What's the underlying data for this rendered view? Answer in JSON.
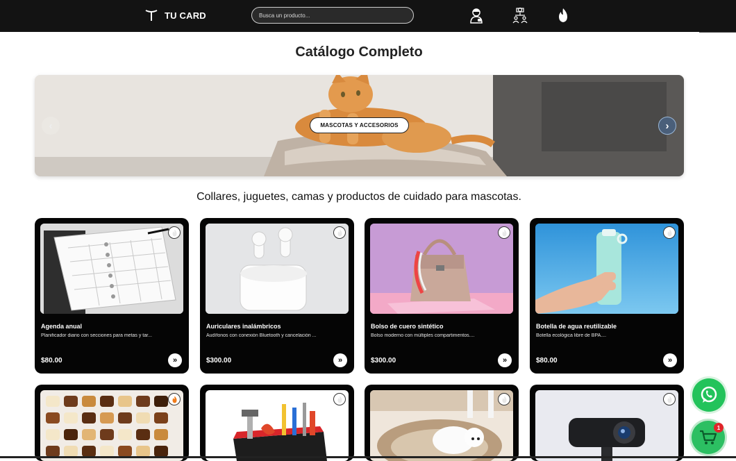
{
  "header": {
    "brand_name": "TU CARD",
    "search_placeholder": "Busca un producto...",
    "nav_icons": [
      "support-agent-icon",
      "team-network-icon",
      "flame-icon"
    ]
  },
  "page_title": "Catálogo Completo",
  "banner": {
    "category_label": "MASCOTAS Y ACCESORIOS",
    "prev_glyph": "‹",
    "next_glyph": "›"
  },
  "category_description": "Collares, juguetes, camas y productos de cuidado para mascotas.",
  "products": [
    {
      "name": "Agenda anual",
      "description": "Planificador diario con secciones para metas y tar...",
      "price": "$80.00",
      "action_glyph": "»"
    },
    {
      "name": "Auriculares inalámbricos",
      "description": "Audífonos con conexión Bluetooth y cancelación ...",
      "price": "$300.00",
      "action_glyph": "»"
    },
    {
      "name": "Bolso de cuero sintético",
      "description": "Bolso moderno con múltiples compartimentos....",
      "price": "$300.00",
      "action_glyph": "»"
    },
    {
      "name": "Botella de agua reutilizable",
      "description": "Botella ecológica libre de BPA....",
      "price": "$80.00",
      "action_glyph": "»"
    }
  ],
  "cart": {
    "count": "1"
  },
  "colors": {
    "header_bg": "#131313",
    "card_bg": "#050505",
    "whatsapp_green": "#23c35b",
    "badge_red": "#e0252a",
    "favorite_active": "#f07c1b"
  }
}
